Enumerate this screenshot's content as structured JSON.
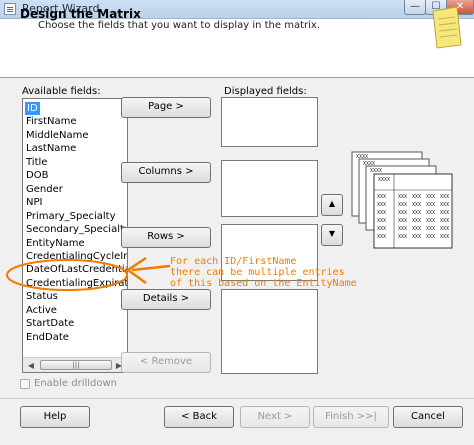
{
  "window": {
    "title": "Report Wizard",
    "min_glyph": "—",
    "max_glyph": "☐",
    "close_glyph": "✕"
  },
  "header": {
    "title": "Design the Matrix",
    "subtitle": "Choose the fields that you want to display in the matrix."
  },
  "available": {
    "label": "Available fields:",
    "selected_index": 0,
    "fields": [
      "ID",
      "FirstName",
      "MiddleName",
      "LastName",
      "Title",
      "DOB",
      "Gender",
      "NPI",
      "Primary_Specialty",
      "Secondary_Specialty",
      "EntityName",
      "CredentialingCycleInYe",
      "DateOfLastCredentialing",
      "CredentialingExpiration",
      "Status",
      "Active",
      "StartDate",
      "EndDate"
    ]
  },
  "displayed": {
    "label": "Displayed fields:"
  },
  "buttons": {
    "page": "Page >",
    "columns": "Columns >",
    "rows": "Rows >",
    "details": "Details >",
    "remove": "< Remove",
    "up": "▲",
    "down": "▼"
  },
  "drilldown": {
    "label": "Enable drilldown",
    "checked": false,
    "enabled": false
  },
  "footer": {
    "help": "Help",
    "back": "< Back",
    "next": "Next >",
    "finish": "Finish >>|",
    "cancel": "Cancel"
  },
  "preview": {
    "cell_text": "XXX",
    "header_text": "XXXX"
  },
  "annotation": {
    "lines": [
      "For each ID/FirstName",
      "there can be multiple entries",
      "of this based on the EntityName"
    ]
  },
  "colors": {
    "accent": "#3399ff",
    "annotation": "#f07d00"
  }
}
